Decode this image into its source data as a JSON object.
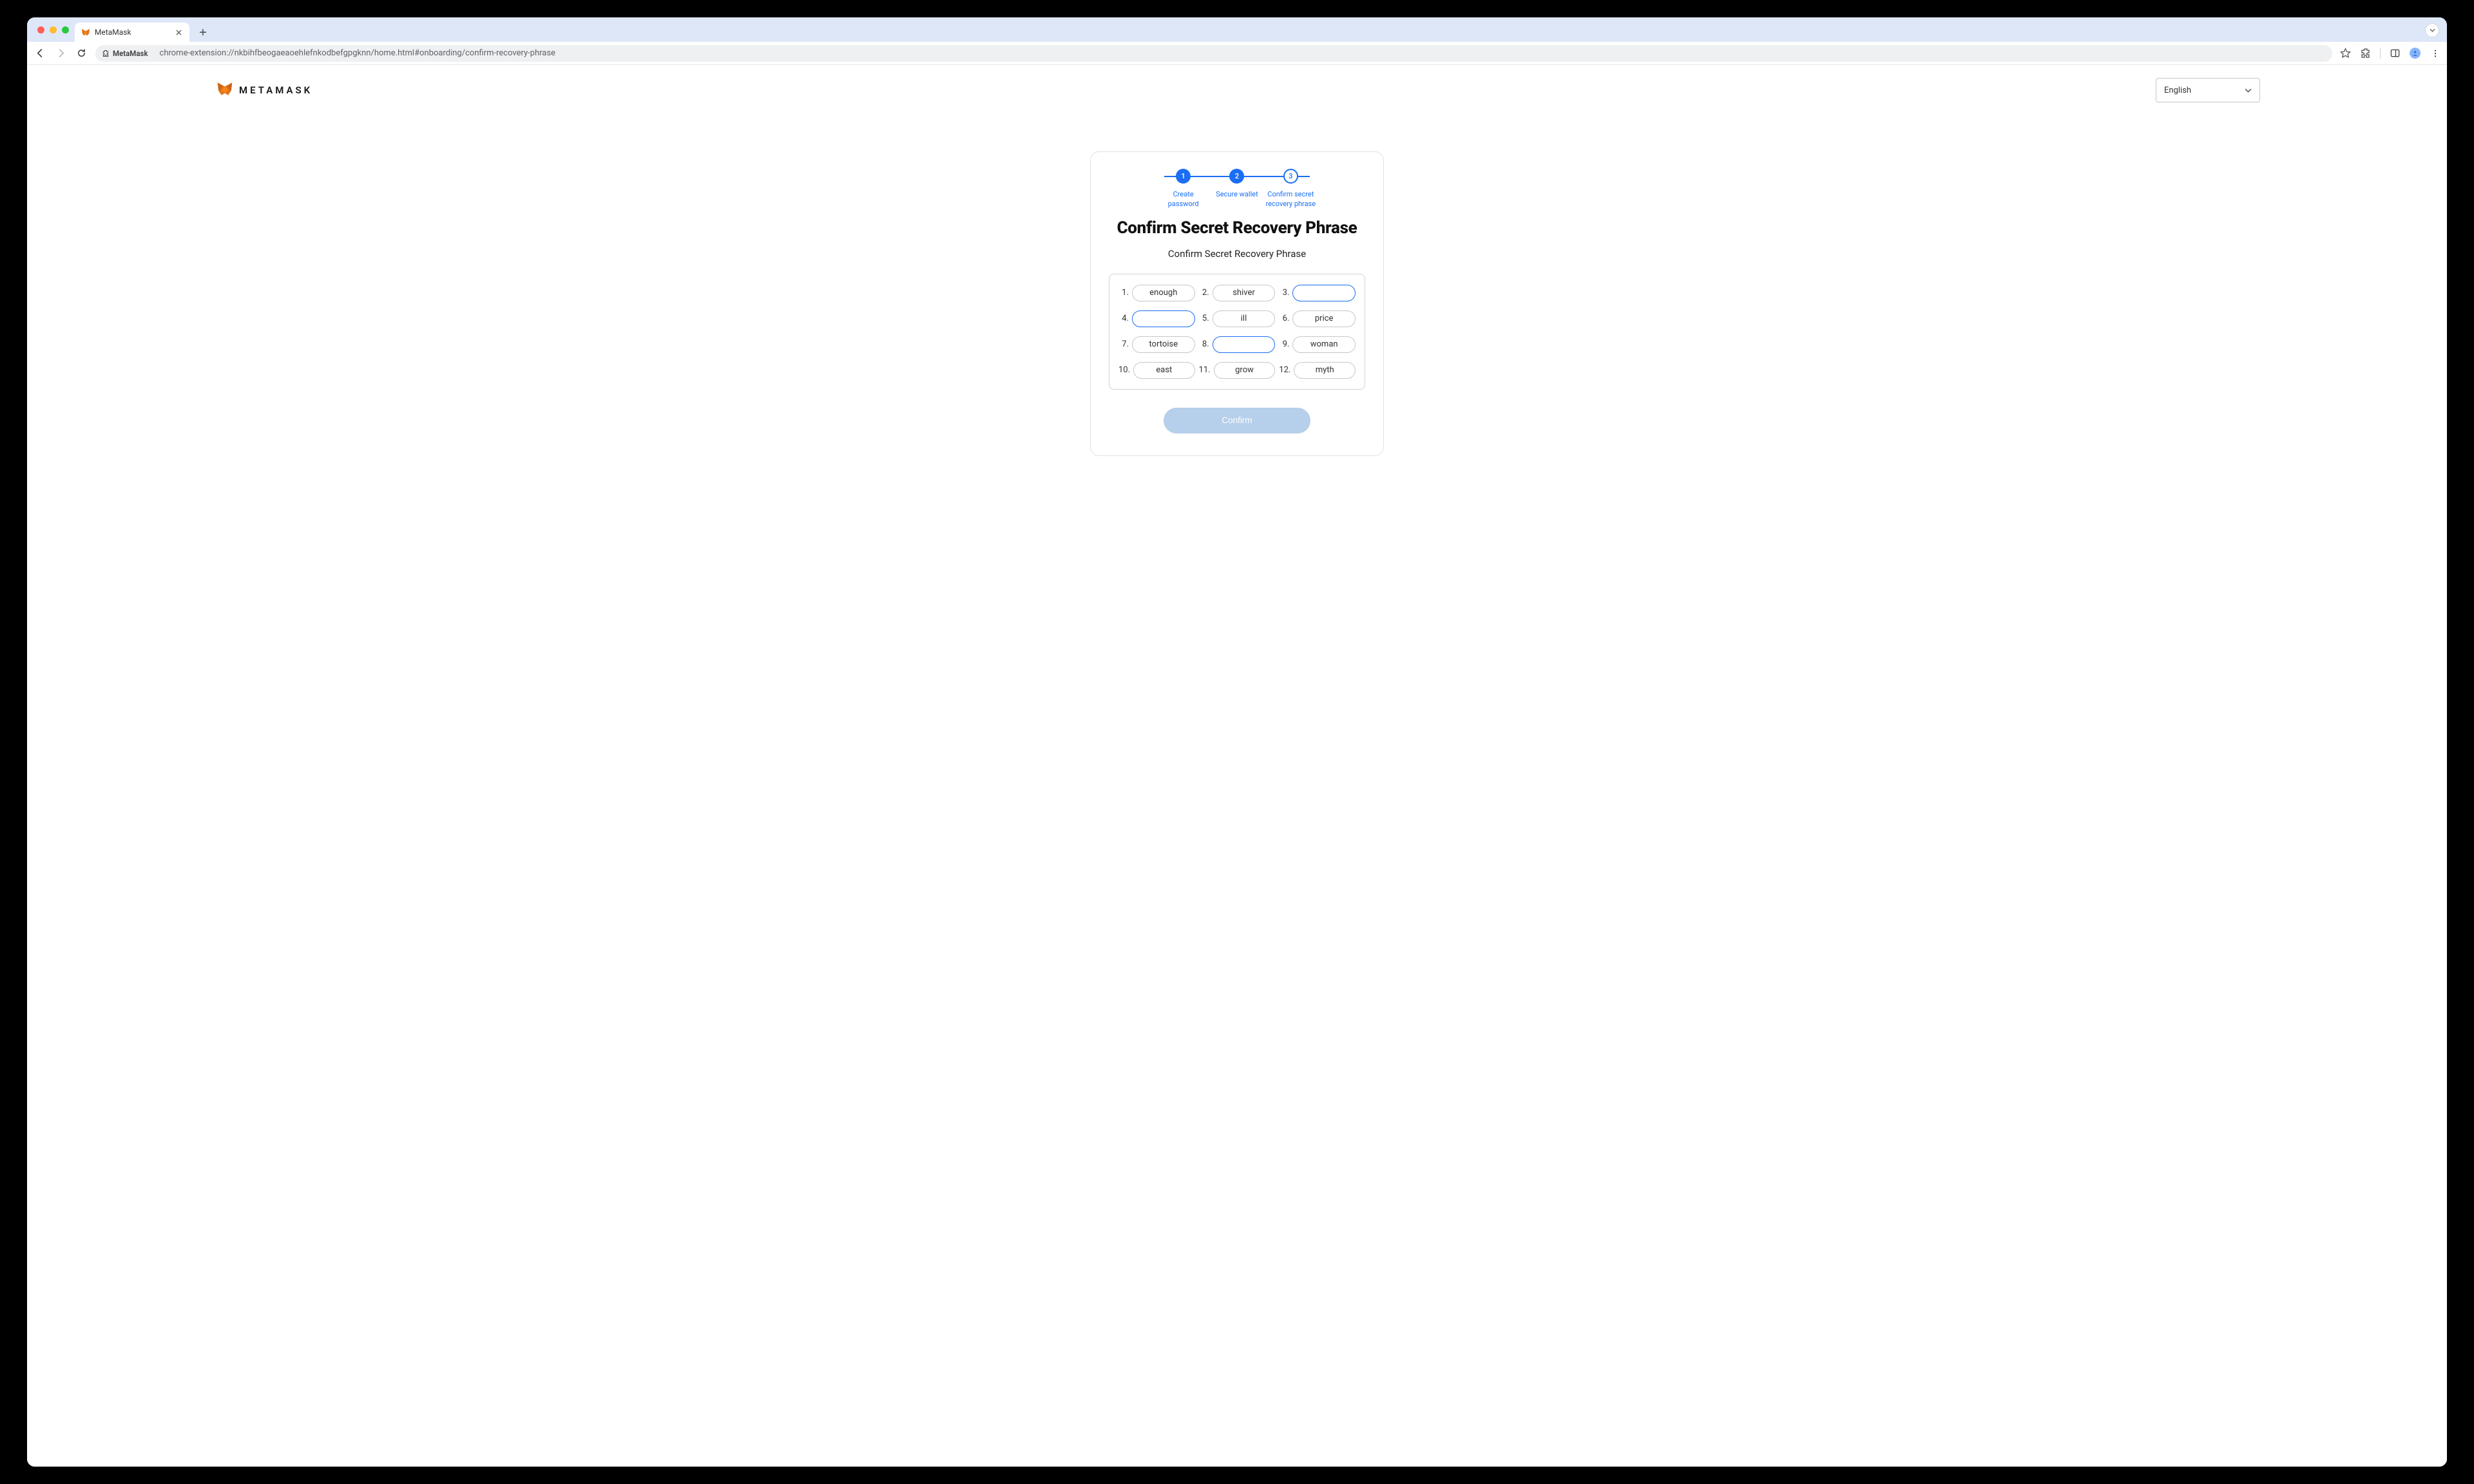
{
  "browser": {
    "tab_title": "MetaMask",
    "extension_name": "MetaMask",
    "url": "chrome-extension://nkbihfbeogaeaoehlefnkodbefgpgknn/home.html#onboarding/confirm-recovery-phrase"
  },
  "header": {
    "brand": "METAMASK",
    "language": "English"
  },
  "stepper": {
    "steps": [
      {
        "num": "1",
        "label": "Create password"
      },
      {
        "num": "2",
        "label": "Secure wallet"
      },
      {
        "num": "3",
        "label": "Confirm secret recovery phrase"
      }
    ]
  },
  "card": {
    "title": "Confirm Secret Recovery Phrase",
    "subtitle": "Confirm Secret Recovery Phrase",
    "confirm_label": "Confirm"
  },
  "phrase": [
    {
      "n": "1.",
      "word": "enough",
      "editable": false
    },
    {
      "n": "2.",
      "word": "shiver",
      "editable": false
    },
    {
      "n": "3.",
      "word": "",
      "editable": true
    },
    {
      "n": "4.",
      "word": "",
      "editable": true
    },
    {
      "n": "5.",
      "word": "ill",
      "editable": false
    },
    {
      "n": "6.",
      "word": "price",
      "editable": false
    },
    {
      "n": "7.",
      "word": "tortoise",
      "editable": false
    },
    {
      "n": "8.",
      "word": "",
      "editable": true
    },
    {
      "n": "9.",
      "word": "woman",
      "editable": false
    },
    {
      "n": "10.",
      "word": "east",
      "editable": false
    },
    {
      "n": "11.",
      "word": "grow",
      "editable": false
    },
    {
      "n": "12.",
      "word": "myth",
      "editable": false
    }
  ]
}
